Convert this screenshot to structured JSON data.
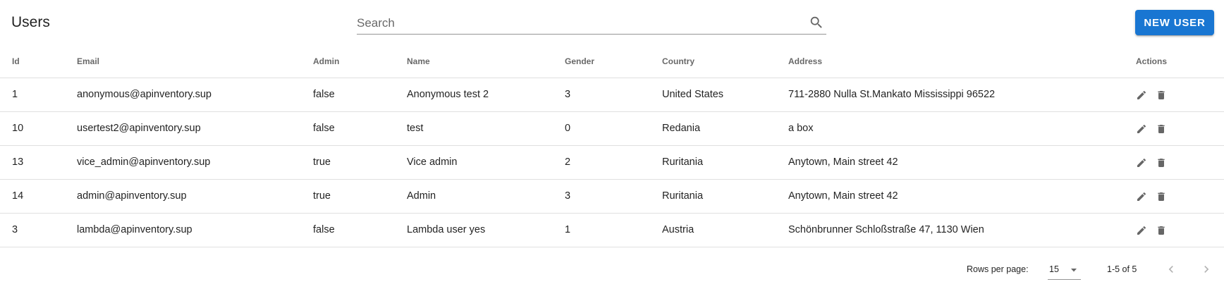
{
  "header": {
    "title": "Users",
    "search_placeholder": "Search",
    "new_user_label": "NEW USER",
    "accent_color": "#1976d2"
  },
  "table": {
    "columns": [
      "Id",
      "Email",
      "Admin",
      "Name",
      "Gender",
      "Country",
      "Address",
      "Actions"
    ],
    "rows": [
      {
        "id": "1",
        "email": "anonymous@apinventory.sup",
        "admin": "false",
        "name": "Anonymous test 2",
        "gender": "3",
        "country": "United States",
        "address": "711-2880 Nulla St.Mankato Mississippi 96522"
      },
      {
        "id": "10",
        "email": "usertest2@apinventory.sup",
        "admin": "false",
        "name": "test",
        "gender": "0",
        "country": "Redania",
        "address": "a box"
      },
      {
        "id": "13",
        "email": "vice_admin@apinventory.sup",
        "admin": "true",
        "name": "Vice admin",
        "gender": "2",
        "country": "Ruritania",
        "address": "Anytown, Main street 42"
      },
      {
        "id": "14",
        "email": "admin@apinventory.sup",
        "admin": "true",
        "name": "Admin",
        "gender": "3",
        "country": "Ruritania",
        "address": "Anytown, Main street 42"
      },
      {
        "id": "3",
        "email": "lambda@apinventory.sup",
        "admin": "false",
        "name": "Lambda user yes",
        "gender": "1",
        "country": "Austria",
        "address": "Schönbrunner Schloßstraße 47, 1130 Wien"
      }
    ],
    "row_icons": [
      "edit-icon",
      "delete-icon"
    ]
  },
  "pagination": {
    "rows_per_page_label": "Rows per page:",
    "rows_per_page_value": "15",
    "range_text": "1-5 of 5",
    "prev_icon": "chevron-left-icon",
    "next_icon": "chevron-right-icon"
  }
}
